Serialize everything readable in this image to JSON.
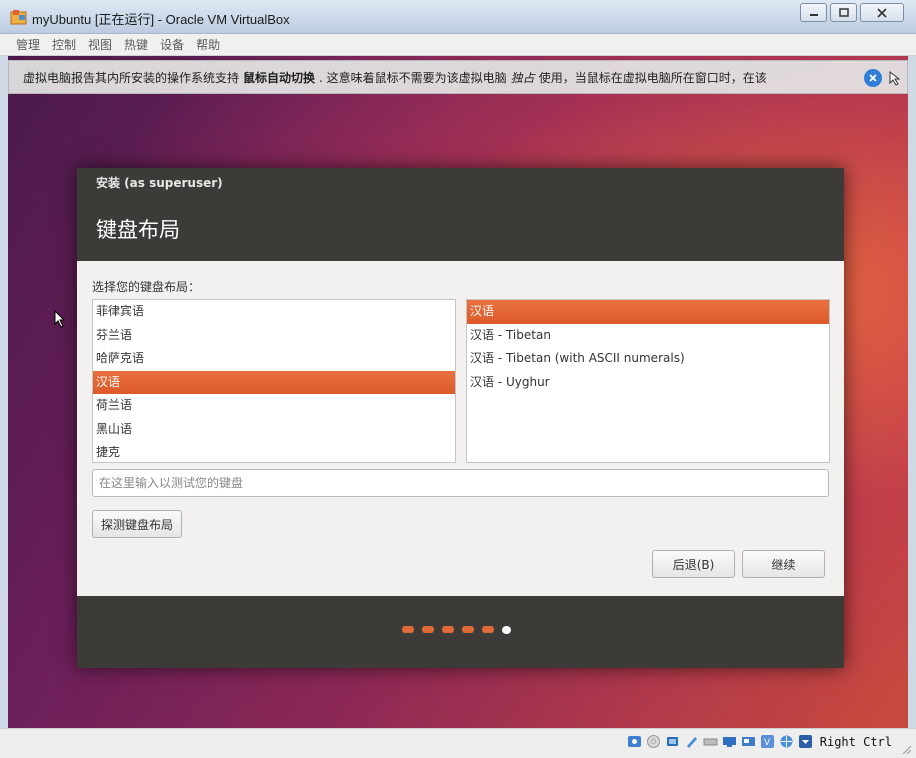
{
  "window": {
    "title": "myUbuntu [正在运行] - Oracle VM VirtualBox"
  },
  "menu": [
    "管理",
    "控制",
    "视图",
    "热键",
    "设备",
    "帮助"
  ],
  "notification": {
    "text_before": "虚拟电脑报告其内所安装的操作系统支持",
    "bold": "鼠标自动切换",
    "text_middle": ". 这意味着鼠标不需要为该虚拟电脑",
    "emph": "独占",
    "text_after": "使用，当鼠标在虚拟电脑所在窗口时，在该"
  },
  "installer": {
    "small_title": "安装 (as superuser)",
    "heading": "键盘布局",
    "choose_label": "选择您的键盘布局：",
    "layouts": [
      {
        "label": "菲律宾语",
        "selected": false
      },
      {
        "label": "芬兰语",
        "selected": false
      },
      {
        "label": "哈萨克语",
        "selected": false
      },
      {
        "label": "汉语",
        "selected": true
      },
      {
        "label": "荷兰语",
        "selected": false
      },
      {
        "label": "黑山语",
        "selected": false
      },
      {
        "label": "捷克",
        "selected": false
      }
    ],
    "variants": [
      {
        "label": "汉语",
        "selected": true
      },
      {
        "label": "汉语 - Tibetan",
        "selected": false
      },
      {
        "label": "汉语 - Tibetan (with ASCII numerals)",
        "selected": false
      },
      {
        "label": "汉语 - Uyghur",
        "selected": false
      }
    ],
    "test_placeholder": "在这里输入以测试您的键盘",
    "detect_button": "探测键盘布局",
    "back_button": "后退(B)",
    "continue_button": "继续",
    "progress": {
      "completed": 5,
      "current": 6,
      "total": 6
    }
  },
  "statusbar": {
    "host_key": "Right Ctrl"
  },
  "colors": {
    "accent": "#e06a35",
    "dialog_header": "#3c3b37"
  }
}
